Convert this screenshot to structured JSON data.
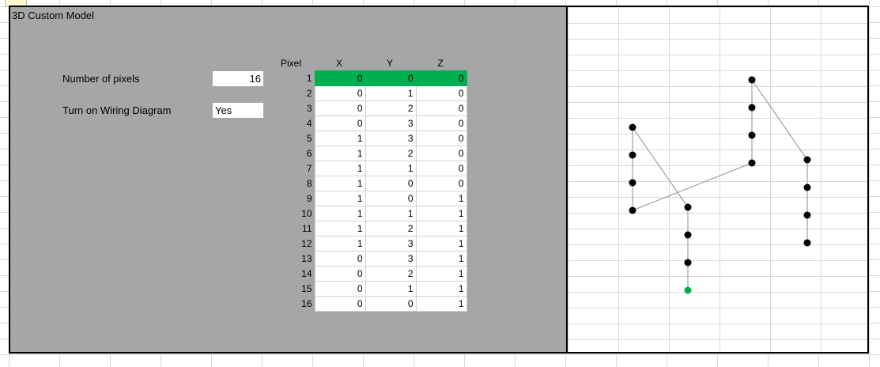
{
  "sheet": {
    "model_title": "3D Custom Model"
  },
  "settings": {
    "pixels_label": "Number of pixels",
    "pixels_value": "16",
    "wiring_label": "Turn on Wiring Diagram",
    "wiring_value": "Yes"
  },
  "table": {
    "headers": {
      "pixel": "Pixel",
      "x": "X",
      "y": "Y",
      "z": "Z"
    },
    "rows": [
      {
        "pixel": "1",
        "x": "0",
        "y": "0",
        "z": "0"
      },
      {
        "pixel": "2",
        "x": "0",
        "y": "1",
        "z": "0"
      },
      {
        "pixel": "3",
        "x": "0",
        "y": "2",
        "z": "0"
      },
      {
        "pixel": "4",
        "x": "0",
        "y": "3",
        "z": "0"
      },
      {
        "pixel": "5",
        "x": "1",
        "y": "3",
        "z": "0"
      },
      {
        "pixel": "6",
        "x": "1",
        "y": "2",
        "z": "0"
      },
      {
        "pixel": "7",
        "x": "1",
        "y": "1",
        "z": "0"
      },
      {
        "pixel": "8",
        "x": "1",
        "y": "0",
        "z": "0"
      },
      {
        "pixel": "9",
        "x": "1",
        "y": "0",
        "z": "1"
      },
      {
        "pixel": "10",
        "x": "1",
        "y": "1",
        "z": "1"
      },
      {
        "pixel": "11",
        "x": "1",
        "y": "2",
        "z": "1"
      },
      {
        "pixel": "12",
        "x": "1",
        "y": "3",
        "z": "1"
      },
      {
        "pixel": "13",
        "x": "0",
        "y": "3",
        "z": "1"
      },
      {
        "pixel": "14",
        "x": "0",
        "y": "2",
        "z": "1"
      },
      {
        "pixel": "15",
        "x": "0",
        "y": "1",
        "z": "1"
      },
      {
        "pixel": "16",
        "x": "0",
        "y": "0",
        "z": "1"
      }
    ]
  },
  "colors": {
    "first_pixel": "#00b050",
    "pixel_dot": "#000000",
    "wire": "#8c8c8c",
    "panel_bg": "#a6a6a6"
  }
}
